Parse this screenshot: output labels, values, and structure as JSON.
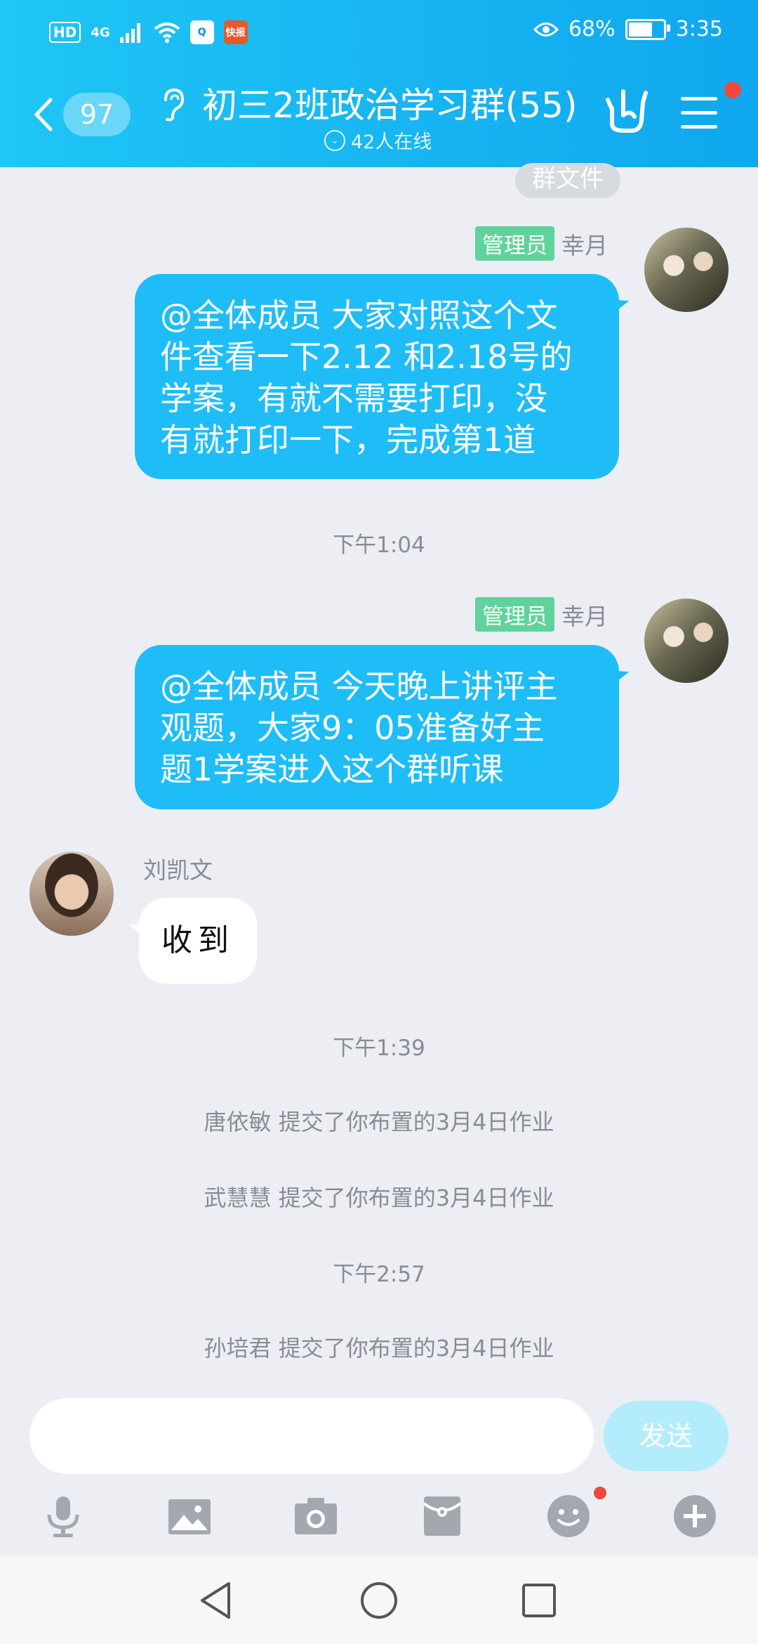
{
  "status_bar": {
    "hd": "HD",
    "network": "4G",
    "app1_icon": "qq-browser-icon",
    "app2": "快报",
    "battery": "68%",
    "battery_level": 0.68,
    "time": "3:35"
  },
  "header": {
    "unread_count": "97",
    "title": "初三2班政治学习群(55)",
    "online": "42人在线"
  },
  "chat": {
    "group_file_tag": "群文件",
    "messages": [
      {
        "admin_tag": "管理员",
        "sender": "幸月",
        "lines": [
          "@全体成员 大家对照这个文",
          "件查看一下2.12 和2.18号的",
          "学案，有就不需要打印，没",
          "有就打印一下，完成第1道"
        ]
      },
      {
        "timestamp": "下午1:04"
      },
      {
        "admin_tag": "管理员",
        "sender": "幸月",
        "lines": [
          "@全体成员 今天晚上讲评主",
          "观题，大家9：05准备好主",
          "题1学案进入这个群听课"
        ]
      },
      {
        "sender": "刘凯文",
        "text": "收到"
      }
    ],
    "timestamp_2": "下午1:39",
    "sys_1": "唐依敏 提交了你布置的3月4日作业",
    "sys_2": "武慧慧 提交了你布置的3月4日作业",
    "timestamp_3": "下午2:57",
    "sys_3": "孙培君 提交了你布置的3月4日作业"
  },
  "input": {
    "value": "",
    "send_label": "发送"
  },
  "toolbar": [
    "microphone-icon",
    "image-icon",
    "camera-icon",
    "red-packet-icon",
    "emoji-icon",
    "plus-icon"
  ],
  "navbar": [
    "back-triangle-icon",
    "home-circle-icon",
    "recents-square-icon"
  ],
  "colors": {
    "header_start": "#1fc6f6",
    "header_end": "#10a7ee",
    "bubble_out": "#1ebdf8",
    "admin_tag": "#5fd39b",
    "background": "#eceef4"
  }
}
